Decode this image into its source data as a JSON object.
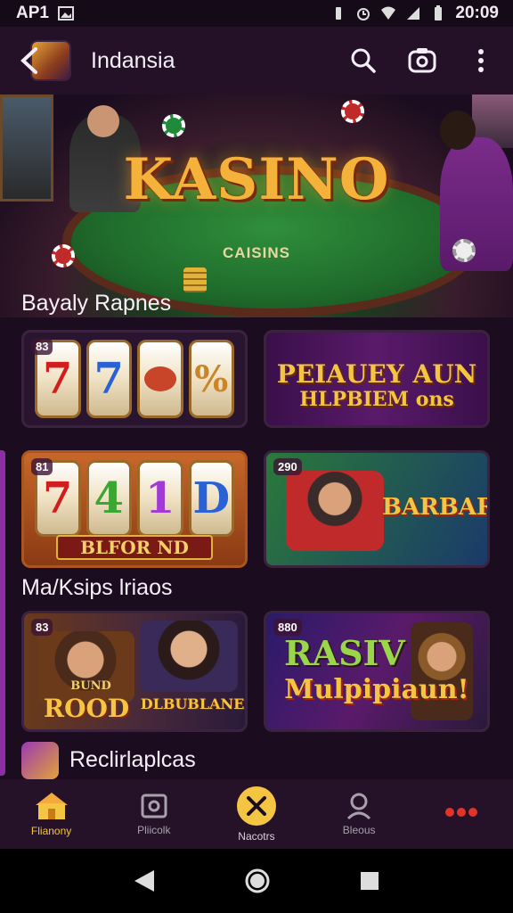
{
  "status_bar": {
    "carrier": "AP1",
    "time": "20:09"
  },
  "app_bar": {
    "title": "Indansia",
    "icons": [
      "back-icon",
      "search-icon",
      "camera-icon",
      "more-vertical-icon"
    ]
  },
  "hero": {
    "title": "KASINO",
    "subtitle": "CAISINS"
  },
  "sections": [
    {
      "title": "Bayaly Rapnes",
      "cards": [
        {
          "badge": "83",
          "reels": [
            "7",
            "7",
            "",
            "%"
          ],
          "caption": ""
        },
        {
          "badge": "",
          "line1": "PEIAUEY AUN",
          "line2": "HLPBIEM ons"
        },
        {
          "badge": "81",
          "reels": [
            "7",
            "4",
            "1",
            "D"
          ],
          "caption": "BLFOR ND"
        },
        {
          "badge": "290",
          "line1": "BARBAR",
          "line2": ""
        }
      ]
    },
    {
      "title": "Ma/Ksips lriaos",
      "cards": [
        {
          "badge": "83",
          "line1": "BUND",
          "line2": "ROOD",
          "line3": "DLBUBLANE"
        },
        {
          "badge": "880",
          "line1": "RASIV",
          "line2": "Mulpipiaun!"
        }
      ]
    },
    {
      "title": "Reclirlaplcas"
    }
  ],
  "bottom_nav": [
    {
      "label": "Flianony",
      "icon": "home-icon",
      "active": true
    },
    {
      "label": "Pliicolk",
      "icon": "wallet-icon",
      "active": false
    },
    {
      "label": "Nacotrs",
      "icon": "swords-icon",
      "active": false
    },
    {
      "label": "Bleous",
      "icon": "user-icon",
      "active": false
    },
    {
      "label": "",
      "icon": "more-dots-icon",
      "active": false
    }
  ],
  "colors": {
    "background": "#1b0d1f",
    "app_bar": "#241127",
    "accent": "#f4c542",
    "purple": "#8c2fa4"
  }
}
